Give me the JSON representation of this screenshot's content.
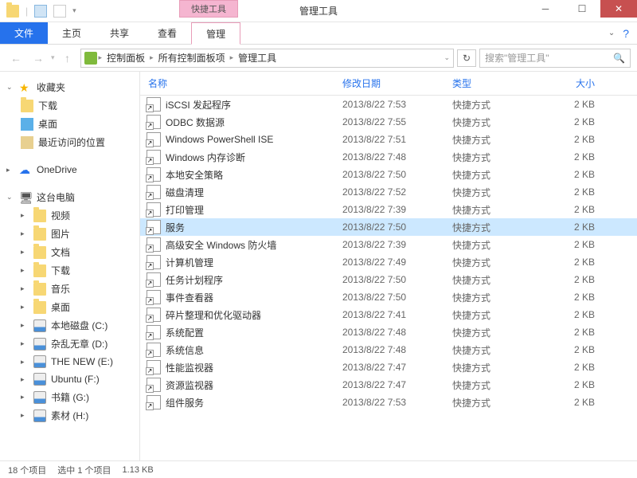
{
  "title_tab": "快捷工具",
  "window_title": "管理工具",
  "ribbon": {
    "file": "文件",
    "tabs": [
      "主页",
      "共享",
      "查看",
      "管理"
    ]
  },
  "breadcrumb": [
    "控制面板",
    "所有控制面板项",
    "管理工具"
  ],
  "search_placeholder": "搜索\"管理工具\"",
  "sidebar": {
    "favorites": {
      "label": "收藏夹",
      "items": [
        "下载",
        "桌面",
        "最近访问的位置"
      ]
    },
    "onedrive": "OneDrive",
    "thispc": {
      "label": "这台电脑",
      "items": [
        "视频",
        "图片",
        "文档",
        "下载",
        "音乐",
        "桌面",
        "本地磁盘 (C:)",
        "杂乱无章 (D:)",
        "THE NEW (E:)",
        "Ubuntu (F:)",
        "书籍 (G:)",
        "素材 (H:)"
      ]
    }
  },
  "columns": {
    "name": "名称",
    "date": "修改日期",
    "type": "类型",
    "size": "大小"
  },
  "files": [
    {
      "name": "iSCSI 发起程序",
      "date": "2013/8/22 7:53",
      "type": "快捷方式",
      "size": "2 KB"
    },
    {
      "name": "ODBC 数据源",
      "date": "2013/8/22 7:55",
      "type": "快捷方式",
      "size": "2 KB"
    },
    {
      "name": "Windows PowerShell ISE",
      "date": "2013/8/22 7:51",
      "type": "快捷方式",
      "size": "2 KB"
    },
    {
      "name": "Windows 内存诊断",
      "date": "2013/8/22 7:48",
      "type": "快捷方式",
      "size": "2 KB"
    },
    {
      "name": "本地安全策略",
      "date": "2013/8/22 7:50",
      "type": "快捷方式",
      "size": "2 KB"
    },
    {
      "name": "磁盘清理",
      "date": "2013/8/22 7:52",
      "type": "快捷方式",
      "size": "2 KB"
    },
    {
      "name": "打印管理",
      "date": "2013/8/22 7:39",
      "type": "快捷方式",
      "size": "2 KB"
    },
    {
      "name": "服务",
      "date": "2013/8/22 7:50",
      "type": "快捷方式",
      "size": "2 KB",
      "selected": true
    },
    {
      "name": "高级安全 Windows 防火墙",
      "date": "2013/8/22 7:39",
      "type": "快捷方式",
      "size": "2 KB"
    },
    {
      "name": "计算机管理",
      "date": "2013/8/22 7:49",
      "type": "快捷方式",
      "size": "2 KB"
    },
    {
      "name": "任务计划程序",
      "date": "2013/8/22 7:50",
      "type": "快捷方式",
      "size": "2 KB"
    },
    {
      "name": "事件查看器",
      "date": "2013/8/22 7:50",
      "type": "快捷方式",
      "size": "2 KB"
    },
    {
      "name": "碎片整理和优化驱动器",
      "date": "2013/8/22 7:41",
      "type": "快捷方式",
      "size": "2 KB"
    },
    {
      "name": "系统配置",
      "date": "2013/8/22 7:48",
      "type": "快捷方式",
      "size": "2 KB"
    },
    {
      "name": "系统信息",
      "date": "2013/8/22 7:48",
      "type": "快捷方式",
      "size": "2 KB"
    },
    {
      "name": "性能监视器",
      "date": "2013/8/22 7:47",
      "type": "快捷方式",
      "size": "2 KB"
    },
    {
      "name": "资源监视器",
      "date": "2013/8/22 7:47",
      "type": "快捷方式",
      "size": "2 KB"
    },
    {
      "name": "组件服务",
      "date": "2013/8/22 7:53",
      "type": "快捷方式",
      "size": "2 KB"
    }
  ],
  "statusbar": {
    "count": "18 个项目",
    "selected": "选中 1 个项目",
    "size": "1.13 KB"
  }
}
